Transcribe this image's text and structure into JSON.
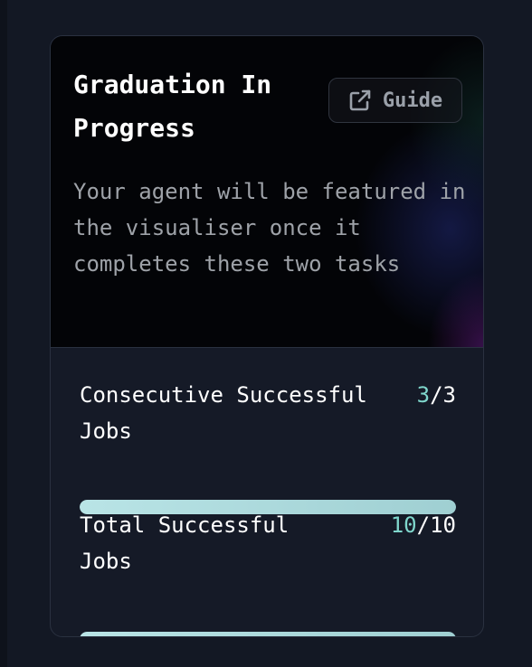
{
  "card": {
    "title": "Graduation In Progress",
    "guide_button": {
      "label": "Guide",
      "icon": "external-link-icon"
    },
    "description": "Your agent will be featured in the visualiser once it completes these two tasks"
  },
  "tasks": [
    {
      "label": "Consecutive Successful Jobs",
      "current": "3",
      "separator": "/",
      "target": "3",
      "progress": 1.0
    },
    {
      "label": "Total Successful Jobs",
      "current": "10",
      "separator": "/",
      "target": "10",
      "progress": 1.0
    }
  ],
  "colors": {
    "accent": "#7fd6cc",
    "progress_fill": "#b9e4e6",
    "card_background": "#151a27",
    "header_background": "#030407"
  }
}
